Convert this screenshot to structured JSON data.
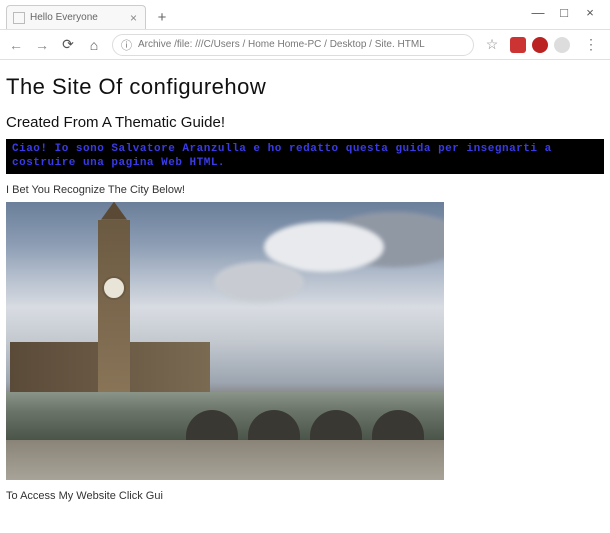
{
  "window": {
    "minimize": "—",
    "maximize": "□",
    "close": "×"
  },
  "tab": {
    "title": "Hello Everyone",
    "close": "×",
    "newtab": "+"
  },
  "nav": {
    "back": "←",
    "forward": "→",
    "reload": "⟳",
    "home": "⌂",
    "info": "ⓘ",
    "url": "Archive /file: ///C/Users / Home Home-PC / Desktop / Site. HTML",
    "star": "☆",
    "menu": "⋮"
  },
  "page": {
    "heading": "The Site Of  configurehow",
    "subheading": "Created From A Thematic Guide!",
    "banner_line1": "Ciao! Io sono Salvatore Aranzulla e ho redatto questa guida per insegnarti a",
    "banner_line2": "costruire una pagina Web HTML.",
    "caption": "I Bet You Recognize The City Below!",
    "footer": "To Access My Website Click Gui"
  }
}
